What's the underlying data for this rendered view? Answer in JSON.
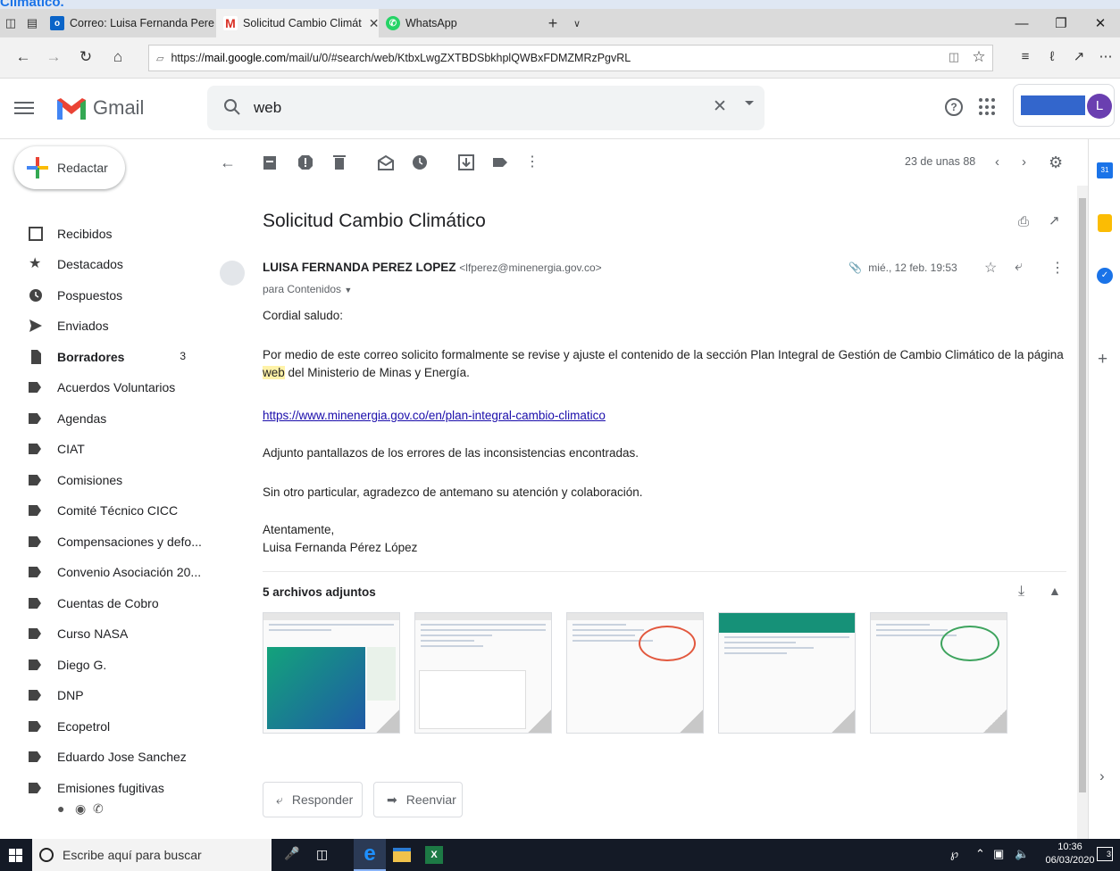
{
  "top_strip_text": "Climatico.",
  "browser": {
    "tabs": [
      {
        "label": "Correo: Luisa Fernanda Pere",
        "icon": "outlook-icon",
        "color": "#0a64c8"
      },
      {
        "label": "Solicitud Cambio Climát",
        "icon": "gmail-icon",
        "color": "#d93025"
      },
      {
        "label": "WhatsApp",
        "icon": "whatsapp-icon",
        "color": "#25d366"
      }
    ],
    "new_tab": "+",
    "url_prefix": "https://",
    "url_host": "mail.google.com",
    "url_path": "/mail/u/0/#search/web/KtbxLwgZXTBDSbkhplQWBxFDMZMRzPgvRL"
  },
  "gmail": {
    "brand": "Gmail",
    "search_value": "web",
    "avatar_letter": "L",
    "compose_label": "Redactar",
    "nav": [
      {
        "label": "Recibidos",
        "icon": "inbox-icon",
        "count": "",
        "bold": false
      },
      {
        "label": "Destacados",
        "icon": "star-icon",
        "count": "",
        "bold": false
      },
      {
        "label": "Pospuestos",
        "icon": "clock-icon",
        "count": "",
        "bold": false
      },
      {
        "label": "Enviados",
        "icon": "send-icon",
        "count": "",
        "bold": false
      },
      {
        "label": "Borradores",
        "icon": "draft-icon",
        "count": "3",
        "bold": true
      },
      {
        "label": "Acuerdos Voluntarios",
        "icon": "label-icon",
        "count": "",
        "bold": false
      },
      {
        "label": "Agendas",
        "icon": "label-icon",
        "count": "",
        "bold": false
      },
      {
        "label": "CIAT",
        "icon": "label-icon",
        "count": "",
        "bold": false
      },
      {
        "label": "Comisiones",
        "icon": "label-icon",
        "count": "",
        "bold": false
      },
      {
        "label": "Comité Técnico CICC",
        "icon": "label-icon",
        "count": "",
        "bold": false
      },
      {
        "label": "Compensaciones y defo...",
        "icon": "label-icon",
        "count": "",
        "bold": false
      },
      {
        "label": "Convenio Asociación 20...",
        "icon": "label-icon",
        "count": "",
        "bold": false
      },
      {
        "label": "Cuentas de Cobro",
        "icon": "label-icon",
        "count": "",
        "bold": false
      },
      {
        "label": "Curso NASA",
        "icon": "label-icon",
        "count": "",
        "bold": false
      },
      {
        "label": "Diego G.",
        "icon": "label-icon",
        "count": "",
        "bold": false
      },
      {
        "label": "DNP",
        "icon": "label-icon",
        "count": "",
        "bold": false
      },
      {
        "label": "Ecopetrol",
        "icon": "label-icon",
        "count": "",
        "bold": false
      },
      {
        "label": "Eduardo Jose Sanchez",
        "icon": "label-icon",
        "count": "",
        "bold": false
      },
      {
        "label": "Emisiones fugitivas",
        "icon": "label-icon",
        "count": "",
        "bold": false
      }
    ],
    "pagination": "23 de unas 88"
  },
  "email": {
    "subject": "Solicitud Cambio Climático",
    "sender_name": "LUISA FERNANDA PEREZ LOPEZ",
    "sender_email": "<lfperez@minenergia.gov.co>",
    "to": "para Contenidos",
    "date": "mié., 12 feb. 19:53",
    "greeting": "Cordial saludo:",
    "p1_before": "Por medio de este correo solicito formalmente se revise y ajuste el contenido de la sección Plan Integral de Gestión de Cambio Climático de la página ",
    "p1_highlight": "web",
    "p1_after": " del Ministerio de Minas y Energía.",
    "link": "https://www.minenergia.gov.co/en/plan-integral-cambio-climatico",
    "p2": "Adjunto pantallazos de los errores de las inconsistencias encontradas.",
    "p3": "Sin otro particular, agradezco de antemano su atención y colaboración.",
    "closing": "Atentamente,",
    "signature": "Luisa Fernanda Pérez López",
    "attachments_title": "5 archivos adjuntos",
    "reply_label": "Responder",
    "forward_label": "Reenviar"
  },
  "taskbar": {
    "search_placeholder": "Escribe aquí para buscar",
    "time": "10:36",
    "date": "06/03/2020",
    "notifications": "3"
  }
}
